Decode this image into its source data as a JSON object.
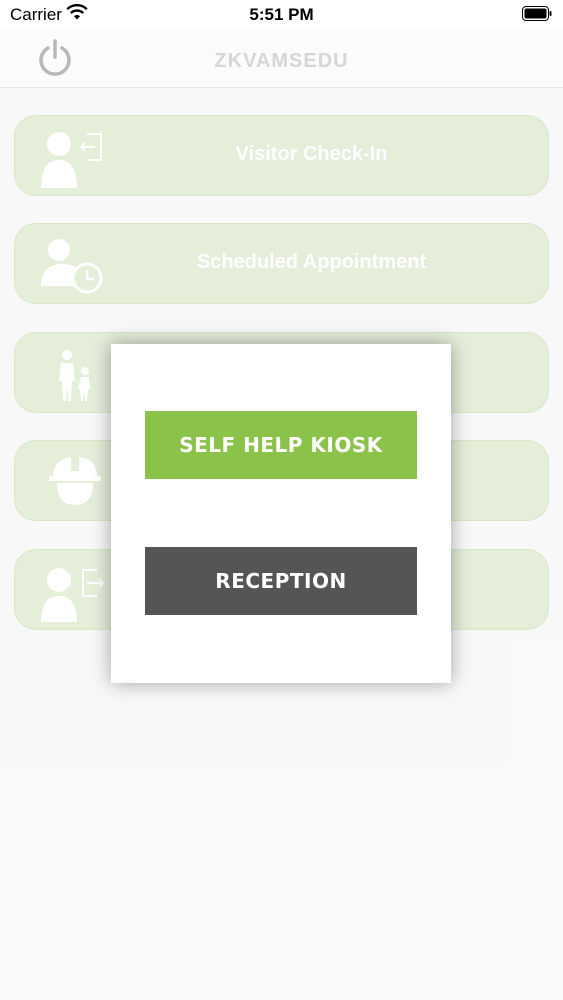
{
  "status_bar": {
    "carrier": "Carrier",
    "time": "5:51 PM"
  },
  "nav": {
    "brand": "ZKVAMSEDU",
    "power_icon": "power-icon"
  },
  "menu": [
    {
      "label": "Visitor Check-In",
      "icon": "visitor-checkin-icon"
    },
    {
      "label": "Scheduled Appointment",
      "icon": "appointment-clock-icon"
    },
    {
      "label": "",
      "icon": "family-icon"
    },
    {
      "label": "",
      "icon": "hard-hat-icon"
    },
    {
      "label": "",
      "icon": "visitor-checkout-icon"
    }
  ],
  "modal": {
    "self_help_label": "SELF HELP KIOSK",
    "reception_label": "RECEPTION",
    "colors": {
      "self_help": "#8bc34a",
      "reception": "#555558"
    }
  }
}
